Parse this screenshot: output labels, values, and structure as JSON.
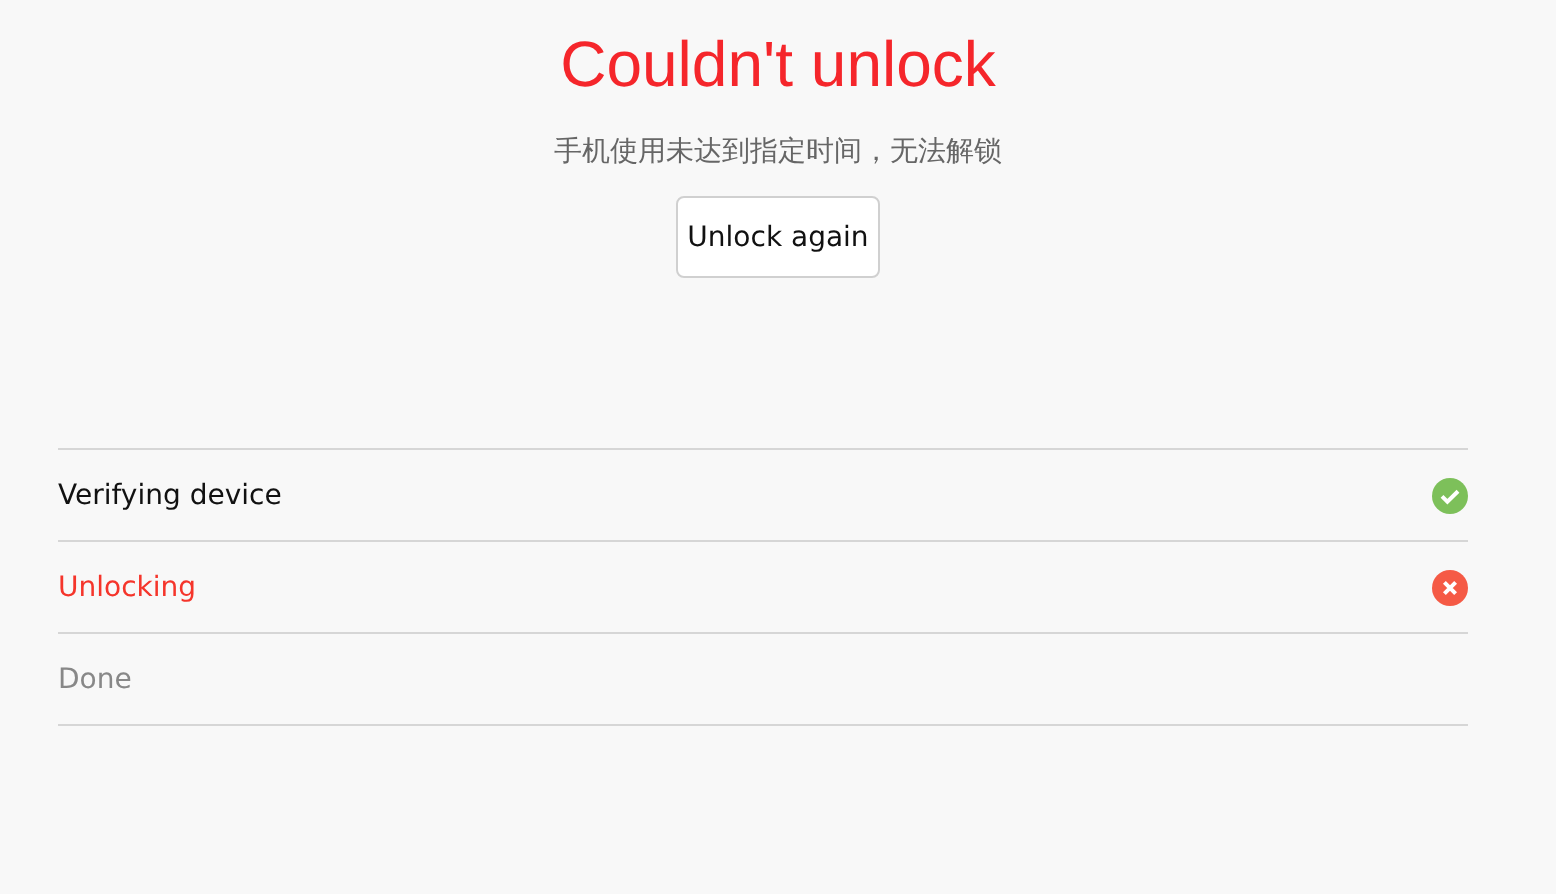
{
  "title": "Couldn't unlock",
  "message": "手机使用未达到指定时间，无法解锁",
  "button": "Unlock again",
  "steps": [
    {
      "label": "Verifying device",
      "kind": "success"
    },
    {
      "label": "Unlocking",
      "kind": "failed"
    },
    {
      "label": "Done",
      "kind": "pending"
    }
  ]
}
